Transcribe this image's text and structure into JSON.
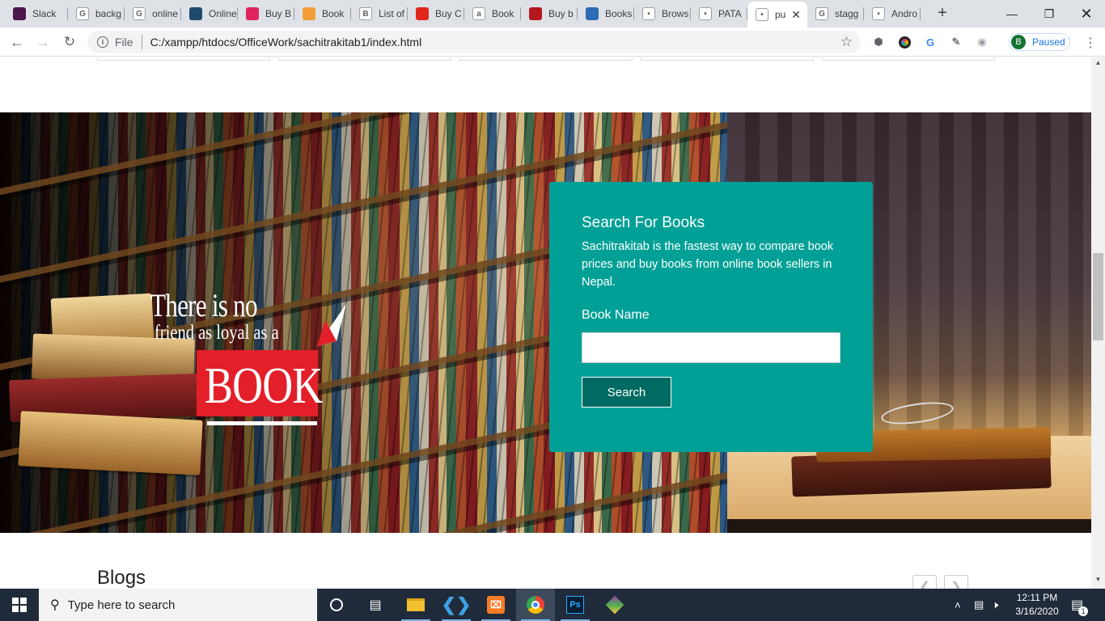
{
  "browser": {
    "tabs": [
      {
        "title": "Slack",
        "icon": "slack-icon",
        "color": "#4a154b"
      },
      {
        "title": "backg",
        "icon": "google-icon",
        "color": "#ffffff"
      },
      {
        "title": "online",
        "icon": "google-icon",
        "color": "#ffffff"
      },
      {
        "title": "Online",
        "icon": "app-icon",
        "color": "#1e4a6e"
      },
      {
        "title": "Buy B",
        "icon": "book-icon",
        "color": "#e0245e"
      },
      {
        "title": "Book",
        "icon": "mail-book-icon",
        "color": "#f29d38"
      },
      {
        "title": "List of",
        "icon": "b-icon",
        "color": "#ffffff"
      },
      {
        "title": "Buy C",
        "icon": "book-icon",
        "color": "#e1261c"
      },
      {
        "title": "Book",
        "icon": "amazon-icon",
        "color": "#ffffff"
      },
      {
        "title": "Buy b",
        "icon": "book-icon",
        "color": "#b3171d"
      },
      {
        "title": "Books",
        "icon": "app-icon",
        "color": "#2c6db3"
      },
      {
        "title": "Brows",
        "icon": "check-icon",
        "color": "#ffffff"
      },
      {
        "title": "PATA",
        "icon": "pata-icon",
        "color": "#ffffff"
      },
      {
        "title": "pu",
        "icon": "globe-icon",
        "color": "#ffffff",
        "active": true
      },
      {
        "title": "stagg",
        "icon": "google-icon",
        "color": "#ffffff"
      },
      {
        "title": "Andro",
        "icon": "stackoverflow-icon",
        "color": "#ffffff"
      }
    ],
    "address": {
      "scheme_label": "File",
      "url": "C:/xampp/htdocs/OfficeWork/sachitrakitab1/index.html"
    },
    "profile": {
      "initial": "B",
      "status": "Paused"
    }
  },
  "page": {
    "quote": {
      "line1": "There is no",
      "line2": "friend as loyal as a",
      "line3": "BOOK"
    },
    "search_card": {
      "title": "Search For Books",
      "description": "Sachitrakitab is the fastest way to compare book prices and buy books from online book sellers in Nepal.",
      "field_label": "Book Name",
      "field_value": "",
      "button_label": "Search",
      "accent": "#00a096",
      "button_color": "#006a63"
    },
    "blogs": {
      "heading": "Blogs",
      "prev": "❮",
      "next": "❯"
    }
  },
  "taskbar": {
    "search_placeholder": "Type here to search",
    "time": "12:11 PM",
    "date": "3/16/2020",
    "notification_count": "1"
  }
}
